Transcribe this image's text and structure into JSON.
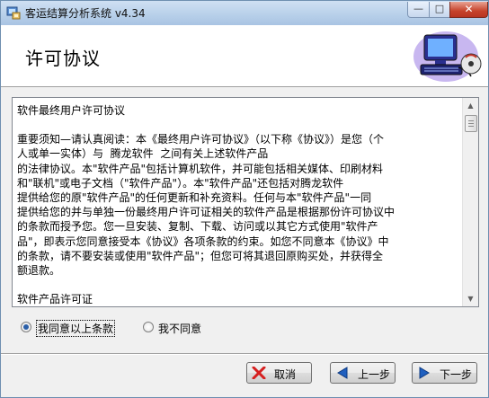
{
  "window": {
    "title": "客运结算分析系统 v4.34",
    "controls": {
      "minimize": "—",
      "maximize": "□",
      "close": "✕"
    }
  },
  "header": {
    "title": "许可协议"
  },
  "license": {
    "lines": [
      "软件最终用户许可协议",
      "",
      "重要须知—请认真阅读：本《最终用户许可协议》（以下称《协议》）是您（个",
      "人或单一实体）与  腾龙软件  之间有关上述软件产品",
      "的法律协议。本\"软件产品\"包括计算机软件，并可能包括相关媒体、印刷材料",
      "和\"联机\"或电子文档（\"软件产品\"）。本\"软件产品\"还包括对腾龙软件",
      "提供给您的原\"软件产品\"的任何更新和补充资料。任何与本\"软件产品\"一同",
      "提供给您的并与单独一份最终用户许可证相关的软件产品是根据那份许可协议中",
      "的条款而授予您。您一旦安装、复制、下载、访问或以其它方式使用\"软件产",
      "品\"，即表示您同意接受本《协议》各项条款的约束。如您不同意本《协议》中",
      "的条款，请不要安装或使用\"软件产品\"；但您可将其退回原购买处，并获得全",
      "额退款。",
      "",
      "软件产品许可证"
    ]
  },
  "options": {
    "agree_label": "我同意以上条款",
    "disagree_label": "我不同意",
    "selected": "agree"
  },
  "buttons": {
    "cancel": "取消",
    "back": "上一步",
    "next": "下一步"
  },
  "icons": {
    "app": "setup-app-icon",
    "header": "computer-disk-icon",
    "cancel": "red-x-icon",
    "back": "left-arrow-icon",
    "next": "right-arrow-icon"
  },
  "colors": {
    "cancel_icon": "#d61f1f",
    "arrow_icon": "#1f5fbf",
    "radio_dot": "#2b5fa8"
  }
}
